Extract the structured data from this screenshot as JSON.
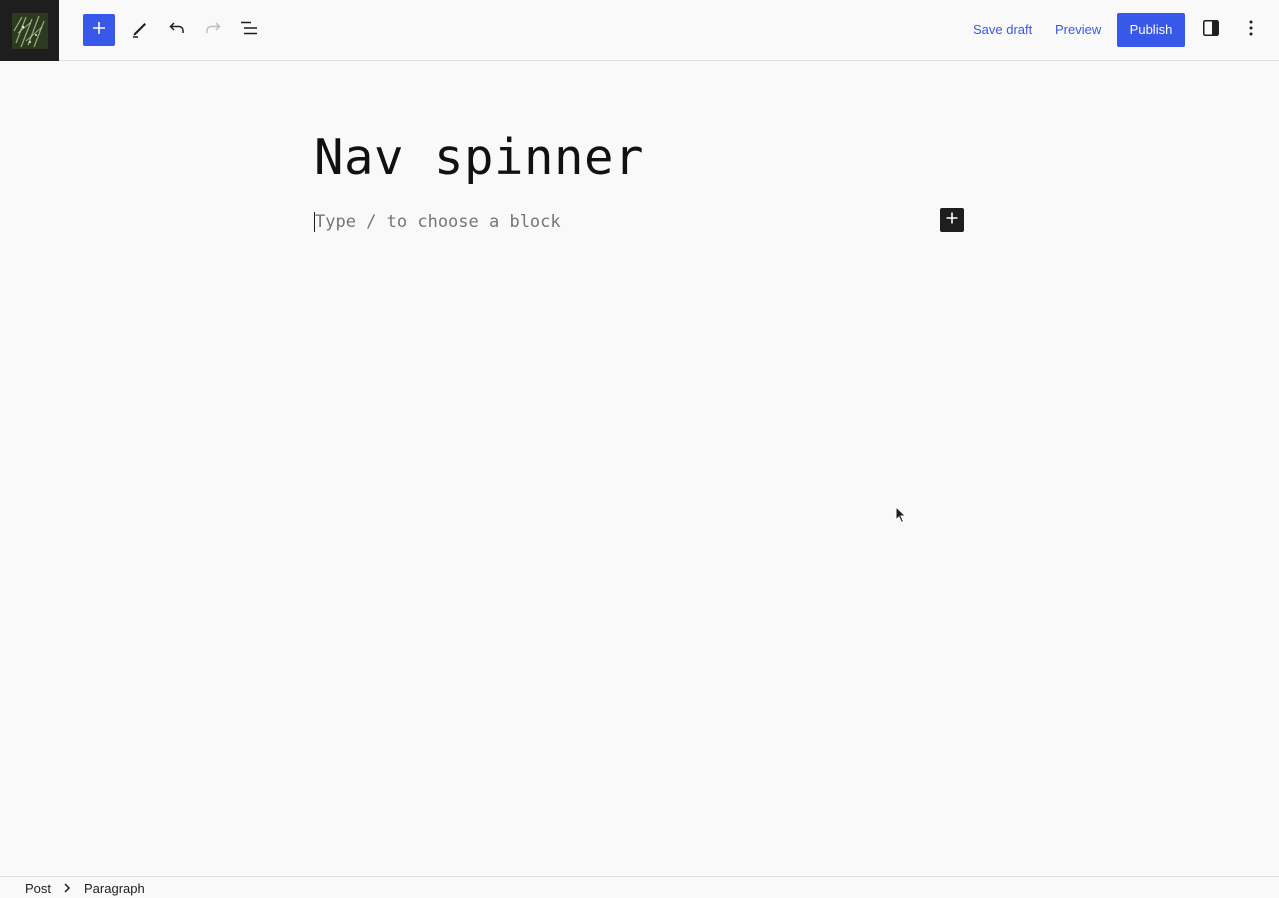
{
  "toolbar": {
    "icons": {
      "logo": "site-logo",
      "inserter": "plus-icon",
      "tools": "pencil-icon",
      "undo": "undo-icon",
      "redo": "redo-icon",
      "outline": "list-view-icon",
      "settings": "sidebar-icon",
      "options": "more-vertical-icon"
    },
    "save_draft_label": "Save draft",
    "preview_label": "Preview",
    "publish_label": "Publish",
    "accent_color": "#3858e9"
  },
  "editor": {
    "title": "Nav spinner",
    "block_placeholder": "Type / to choose a block"
  },
  "breadcrumb": {
    "items": [
      "Post",
      "Paragraph"
    ]
  }
}
